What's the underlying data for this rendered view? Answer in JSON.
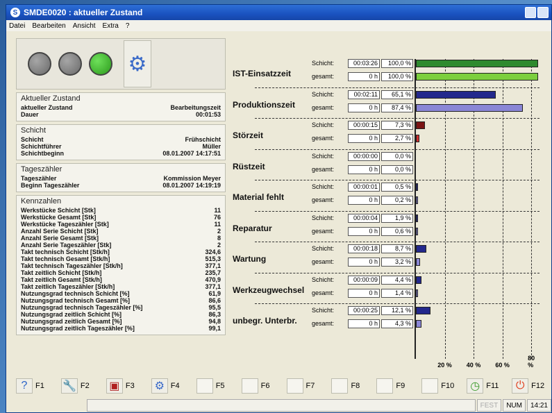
{
  "window": {
    "title": "SMDE0020 : aktueller Zustand"
  },
  "menu": [
    "Datei",
    "Bearbeiten",
    "Ansicht",
    "Extra",
    "?"
  ],
  "lights": [
    "gray",
    "gray",
    "green"
  ],
  "aktuellerZustand": {
    "title": "Aktueller Zustand",
    "rows": [
      {
        "label": "aktueller Zustand",
        "value": "Bearbeitungszeit"
      },
      {
        "label": "Dauer",
        "value": "00:01:53"
      }
    ]
  },
  "schicht": {
    "title": "Schicht",
    "rows": [
      {
        "label": "Schicht",
        "value": "Frühschicht"
      },
      {
        "label": "Schichtführer",
        "value": "Müller"
      },
      {
        "label": "Schichtbeginn",
        "value": "08.01.2007 14:17:51"
      }
    ]
  },
  "tageszaehler": {
    "title": "Tageszähler",
    "rows": [
      {
        "label": "Tageszähler",
        "value": "Kommission Meyer"
      },
      {
        "label": "Beginn Tageszähler",
        "value": "08.01.2007 14:19:19"
      }
    ]
  },
  "kennzahlen": {
    "title": "Kennzahlen",
    "rows": [
      {
        "label": "Werkstücke Schicht [Stk]",
        "value": "11"
      },
      {
        "label": "Werkstücke Gesamt [Stk]",
        "value": "76"
      },
      {
        "label": "Werkstücke Tageszähler [Stk]",
        "value": "11"
      },
      {
        "label": "Anzahl Serie Schicht [Stk]",
        "value": "2"
      },
      {
        "label": "Anzahl Serie Gesamt [Stk]",
        "value": "8"
      },
      {
        "label": "Anzahl Serie Tageszähler [Stk]",
        "value": "2"
      },
      {
        "label": "Takt technisch Schicht [Stk/h]",
        "value": "324,6"
      },
      {
        "label": "Takt technisch Gesamt [Stk/h]",
        "value": "515,3"
      },
      {
        "label": "Takt technisch Tageszähler [Stk/h]",
        "value": "377,1"
      },
      {
        "label": "Takt zeitlich Schicht [Stk/h]",
        "value": "235,7"
      },
      {
        "label": "Takt zeitlich Gesamt [Stk/h]",
        "value": "470,9"
      },
      {
        "label": "Takt zeitlich Tageszähler [Stk/h]",
        "value": "377,1"
      },
      {
        "label": "Nutzungsgrad technisch Schicht [%]",
        "value": "61,9"
      },
      {
        "label": "Nutzungsgrad technisch Gesamt [%]",
        "value": "86,6"
      },
      {
        "label": "Nutzungsgrad technisch Tageszähler [%]",
        "value": "95,5"
      },
      {
        "label": "Nutzungsgrad zeitlich Schicht [%]",
        "value": "86,3"
      },
      {
        "label": "Nutzungsgrad zeitlich Gesamt [%]",
        "value": "94,8"
      },
      {
        "label": "Nutzungsgrad zeitlich Tageszähler [%]",
        "value": "99,1"
      }
    ]
  },
  "chart_data": {
    "type": "bar",
    "axis_ticks": [
      "20 %",
      "40 %",
      "60 %",
      "80 %"
    ],
    "xlim": [
      0,
      100
    ],
    "row_labels": {
      "schicht": "Schicht:",
      "gesamt": "gesamt:"
    },
    "groups": [
      {
        "name": "IST-Einsatzzeit",
        "schicht": {
          "time": "00:03:26",
          "pct": "100,0 %",
          "value": 100.0,
          "color": "#2e8a2e"
        },
        "gesamt": {
          "time": "0 h",
          "pct": "100,0 %",
          "value": 100.0,
          "color": "#7ccf3e"
        }
      },
      {
        "name": "Produktionszeit",
        "schicht": {
          "time": "00:02:11",
          "pct": "65,1 %",
          "value": 65.1,
          "color": "#23288c"
        },
        "gesamt": {
          "time": "0 h",
          "pct": "87,4 %",
          "value": 87.4,
          "color": "#8a86d6"
        }
      },
      {
        "name": "Störzeit",
        "schicht": {
          "time": "00:00:15",
          "pct": "7,3 %",
          "value": 7.3,
          "color": "#7a1414"
        },
        "gesamt": {
          "time": "0 h",
          "pct": "2,7 %",
          "value": 2.7,
          "color": "#d03030"
        }
      },
      {
        "name": "Rüstzeit",
        "schicht": {
          "time": "00:00:00",
          "pct": "0,0 %",
          "value": 0.0,
          "color": "#23288c"
        },
        "gesamt": {
          "time": "0 h",
          "pct": "0,0 %",
          "value": 0.0,
          "color": "#8a86d6"
        }
      },
      {
        "name": "Material fehlt",
        "schicht": {
          "time": "00:00:01",
          "pct": "0,5 %",
          "value": 0.5,
          "color": "#23288c"
        },
        "gesamt": {
          "time": "0 h",
          "pct": "0,2 %",
          "value": 0.2,
          "color": "#8a86d6"
        }
      },
      {
        "name": "Reparatur",
        "schicht": {
          "time": "00:00:04",
          "pct": "1,9 %",
          "value": 1.9,
          "color": "#23288c"
        },
        "gesamt": {
          "time": "0 h",
          "pct": "0,6 %",
          "value": 0.6,
          "color": "#8a86d6"
        }
      },
      {
        "name": "Wartung",
        "schicht": {
          "time": "00:00:18",
          "pct": "8,7 %",
          "value": 8.7,
          "color": "#23288c"
        },
        "gesamt": {
          "time": "0 h",
          "pct": "3,2 %",
          "value": 3.2,
          "color": "#8a86d6"
        }
      },
      {
        "name": "Werkzeugwechsel",
        "schicht": {
          "time": "00:00:09",
          "pct": "4,4 %",
          "value": 4.4,
          "color": "#23288c"
        },
        "gesamt": {
          "time": "0 h",
          "pct": "1,4 %",
          "value": 1.4,
          "color": "#8a86d6"
        }
      },
      {
        "name": "unbegr. Unterbr.",
        "schicht": {
          "time": "00:00:25",
          "pct": "12,1 %",
          "value": 12.1,
          "color": "#23288c"
        },
        "gesamt": {
          "time": "0 h",
          "pct": "4,3 %",
          "value": 4.3,
          "color": "#8a86d6"
        }
      }
    ]
  },
  "fkeys": [
    {
      "label": "F1",
      "icon": "help-icon"
    },
    {
      "label": "F2",
      "icon": "wrench-icon"
    },
    {
      "label": "F3",
      "icon": "machine-icon"
    },
    {
      "label": "F4",
      "icon": "gear-icon"
    },
    {
      "label": "F5",
      "icon": ""
    },
    {
      "label": "F6",
      "icon": ""
    },
    {
      "label": "F7",
      "icon": ""
    },
    {
      "label": "F8",
      "icon": ""
    },
    {
      "label": "F9",
      "icon": ""
    },
    {
      "label": "F10",
      "icon": ""
    },
    {
      "label": "F11",
      "icon": "clock-icon"
    },
    {
      "label": "F12",
      "icon": "power-icon"
    }
  ],
  "status": {
    "fest": "FEST",
    "num": "NUM",
    "time": "14:21"
  }
}
